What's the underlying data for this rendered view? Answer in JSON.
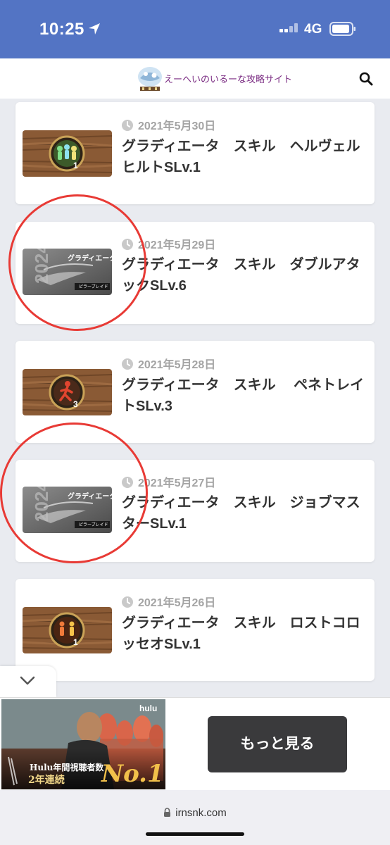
{
  "status_bar": {
    "time": "10:25",
    "network": "4G",
    "background_color": "#5374c4"
  },
  "site_header": {
    "logo_text": "えーへいのいるーな攻略サイト",
    "search_icon": "search-icon"
  },
  "posts": [
    {
      "date": "2021年5月30日",
      "title": "グラディエータ　スキル　ヘルヴェルヒルトSLv.1",
      "thumb": "skill-medallion",
      "badge": "1"
    },
    {
      "date": "2021年5月29日",
      "title": "グラディエータ　スキル　ダブルアタックSLv.6",
      "thumb": "class-banner",
      "banner_title": "グラディエータ",
      "banner_sub": "ピラーブレイド"
    },
    {
      "date": "2021年5月28日",
      "title": "グラディエータ　スキル　 ペネトレイトSLv.3",
      "thumb": "skill-medallion",
      "badge": "3"
    },
    {
      "date": "2021年5月27日",
      "title": "グラディエータ　スキル　ジョブマスターSLv.1",
      "thumb": "class-banner",
      "banner_title": "グラディエータ",
      "banner_sub": "ピラーブレイド"
    },
    {
      "date": "2021年5月26日",
      "title": "グラディエータ　スキル　ロストコロッセオSLv.1",
      "thumb": "skill-medallion",
      "badge": "1"
    }
  ],
  "ad": {
    "brand": "hulu",
    "caption_line1": "Hulu年間視聴者数",
    "caption_line2": "2年連続",
    "badge_text": "No.1",
    "cta_label": "もっと見る"
  },
  "browser": {
    "url": "irnsnk.com"
  },
  "colors": {
    "annotation_red": "#e83a35",
    "title_text": "#333333",
    "date_text": "#a4a4a4"
  }
}
